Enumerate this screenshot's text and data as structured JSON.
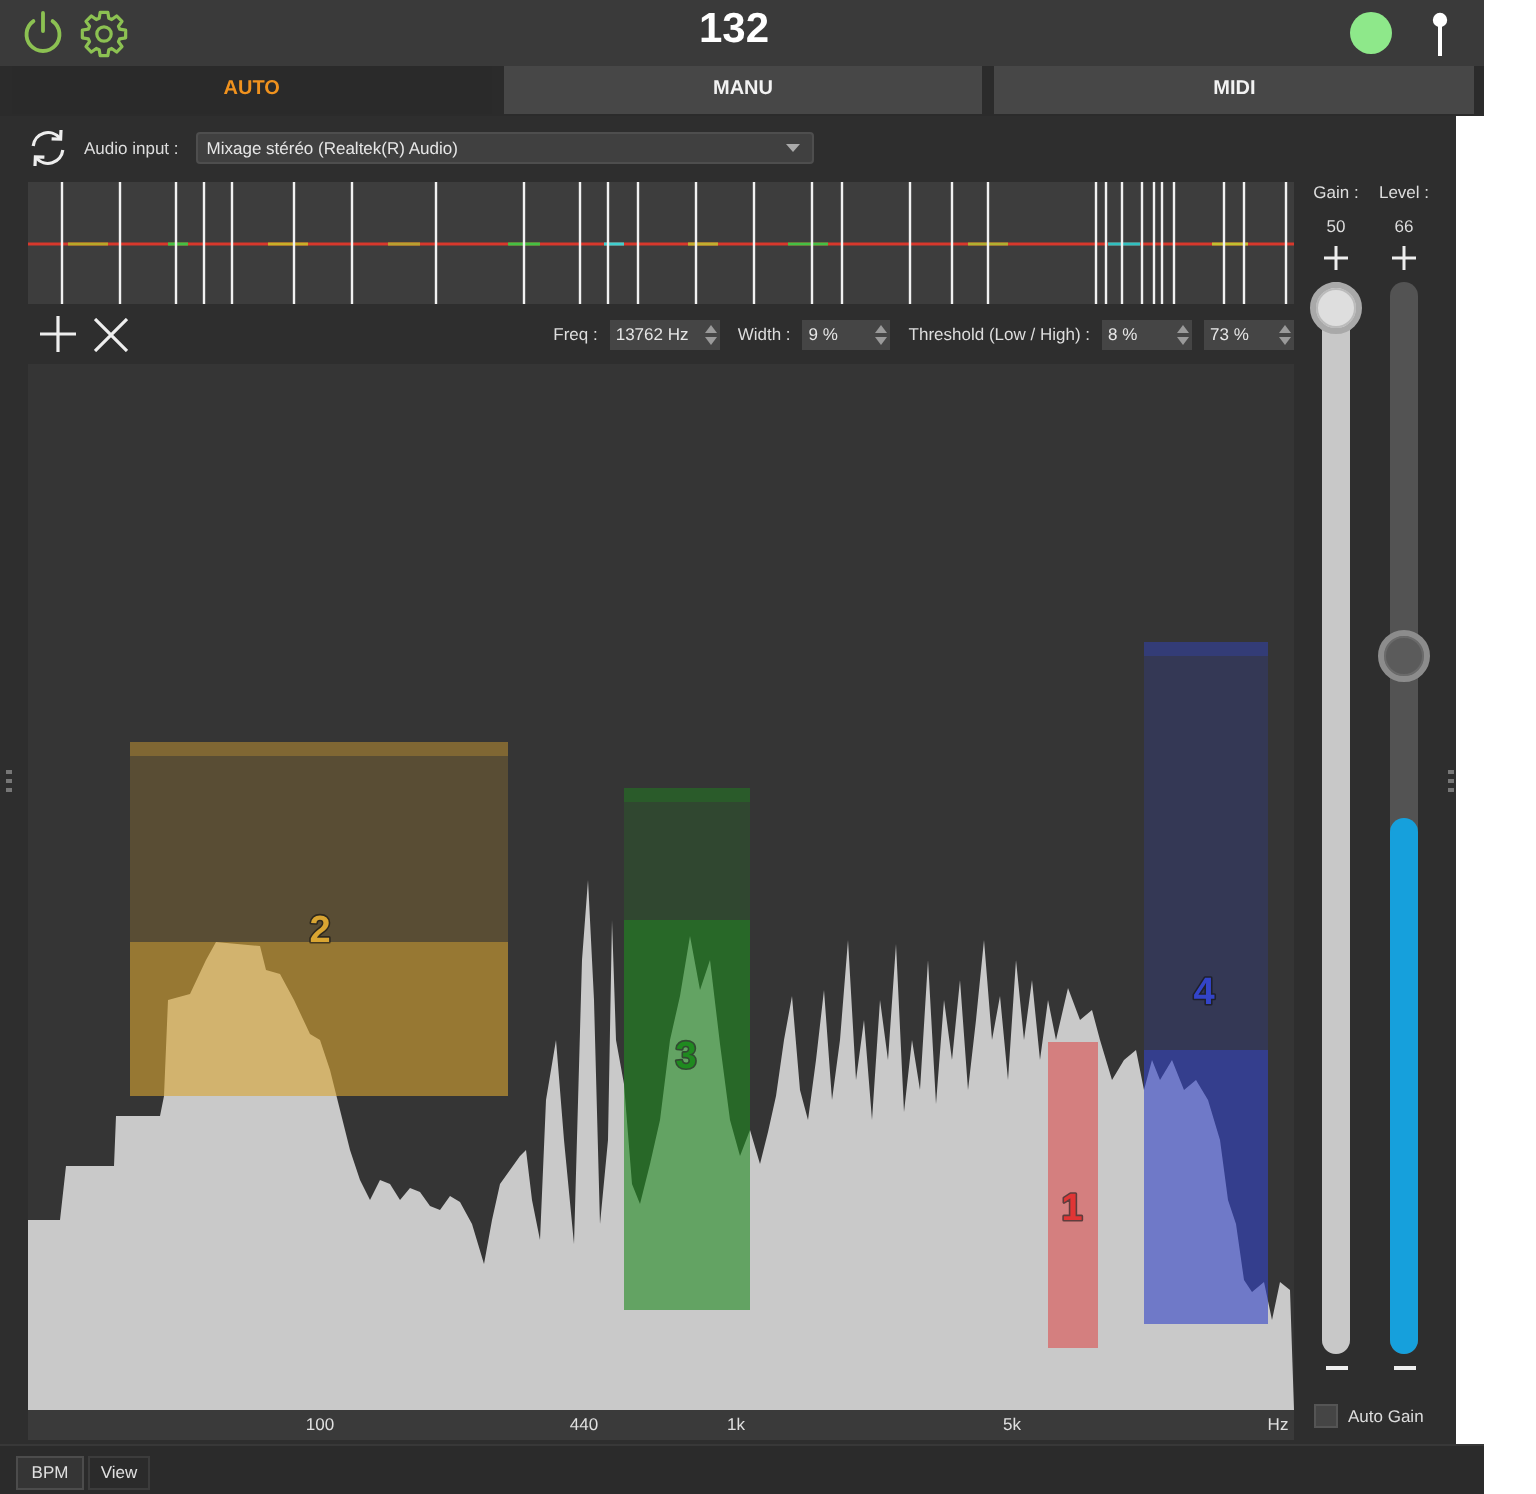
{
  "header": {
    "bpm": "132",
    "status_light": {
      "on": true
    }
  },
  "mode_tabs": [
    {
      "label": "AUTO",
      "selected": true
    },
    {
      "label": "MANU",
      "selected": false
    },
    {
      "label": "MIDI",
      "selected": false
    }
  ],
  "audio_input": {
    "label": "Audio input :",
    "value": "Mixage stéréo (Realtek(R) Audio)"
  },
  "band_settings": [
    {
      "label": "Freq :",
      "value": "13762 Hz"
    },
    {
      "label": "Width :",
      "value": "9 %"
    },
    {
      "label": "Threshold (Low / High) :",
      "value": "8 %"
    },
    {
      "value": "73 %"
    }
  ],
  "bands": [
    {
      "label": "1",
      "color": "#e03535"
    },
    {
      "label": "2",
      "color": "#d9a532"
    },
    {
      "label": "3",
      "color": "#1f8a1f"
    },
    {
      "label": "4",
      "color": "#3344c8"
    }
  ],
  "frequency_axis": [
    "100",
    "440",
    "1k",
    "5k",
    "Hz"
  ],
  "sliders": [
    {
      "kind": "fader",
      "label": "Gain :",
      "value": "50",
      "level": 1
    },
    {
      "kind": "meter",
      "label": "Level :",
      "value": "66",
      "level": 0.66,
      "meter": {
        "level": 0.5
      }
    }
  ],
  "auto_gain": {
    "label": "Auto Gain",
    "checked": false
  },
  "bottom_tabs": [
    {
      "label": "BPM",
      "selected": true
    },
    {
      "label": "View",
      "selected": false
    }
  ]
}
